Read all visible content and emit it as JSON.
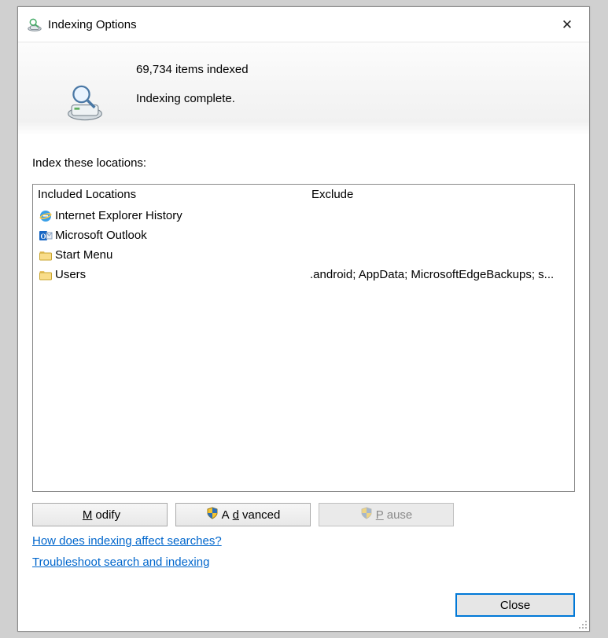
{
  "window": {
    "title": "Indexing Options"
  },
  "status": {
    "count_line": "69,734 items indexed",
    "state_line": "Indexing complete."
  },
  "locations_label": "Index these locations:",
  "columns": {
    "included": "Included Locations",
    "exclude": "Exclude"
  },
  "rows": [
    {
      "icon": "ie",
      "label": "Internet Explorer History",
      "exclude": ""
    },
    {
      "icon": "outlook",
      "label": "Microsoft Outlook",
      "exclude": ""
    },
    {
      "icon": "folder",
      "label": "Start Menu",
      "exclude": ""
    },
    {
      "icon": "folder",
      "label": "Users",
      "exclude": ".android; AppData; MicrosoftEdgeBackups; s..."
    }
  ],
  "buttons": {
    "modify_pre": "",
    "modify_u": "M",
    "modify_post": "odify",
    "advanced_pre": "A",
    "advanced_u": "d",
    "advanced_post": "vanced",
    "pause_u": "P",
    "pause_post": "ause"
  },
  "links": {
    "help": "How does indexing affect searches?",
    "troubleshoot": "Troubleshoot search and indexing"
  },
  "footer": {
    "close": "Close"
  }
}
